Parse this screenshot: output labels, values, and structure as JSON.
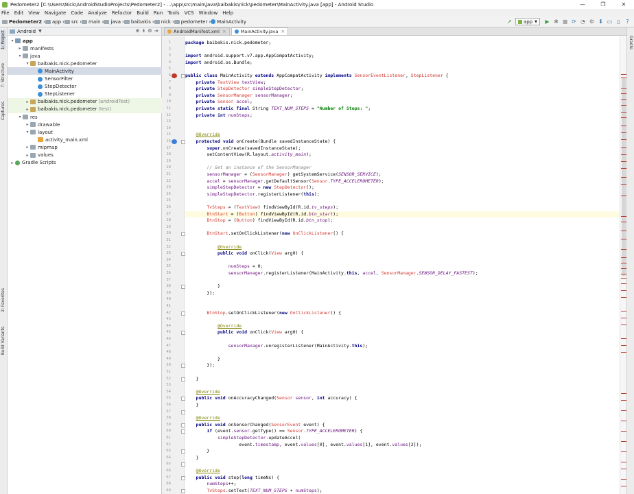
{
  "window": {
    "title": "Pedometer2 [C:\\Users\\Nick\\AndroidStudioProjects\\Pedometer2] - ...\\app\\src\\main\\java\\baibakis\\nick\\pedometer\\MainActivity.java [app] - Android Studio",
    "minimize": "—",
    "maximize": "❐",
    "close": "✕"
  },
  "menu": [
    "File",
    "Edit",
    "View",
    "Navigate",
    "Code",
    "Analyze",
    "Refactor",
    "Build",
    "Run",
    "Tools",
    "VCS",
    "Window",
    "Help"
  ],
  "breadcrumb": [
    "Pedometer2",
    "app",
    "src",
    "main",
    "java",
    "baibakis",
    "nick",
    "pedometer",
    "MainActivity"
  ],
  "toolbar": {
    "run_config": "app",
    "icons": [
      "back-arrow-icon",
      "run-icon",
      "debug-icon",
      "stop-icon",
      "sync-icon",
      "profile-icon",
      "sdk-manager-icon",
      "avd-manager-icon",
      "device-icon",
      "help-icon"
    ]
  },
  "left_tabs": [
    "1: Project",
    "7: Structure",
    "Captures",
    "2: Favorites",
    "Build Variants"
  ],
  "right_tabs": [
    "Gradle"
  ],
  "project_panel": {
    "view_mode": "Android",
    "tree": [
      {
        "label": "app",
        "depth": 0,
        "open": true,
        "icon": "folderblue",
        "bold": true
      },
      {
        "label": "manifests",
        "depth": 1,
        "open": false,
        "icon": "folder"
      },
      {
        "label": "java",
        "depth": 1,
        "open": true,
        "icon": "folder"
      },
      {
        "label": "baibakis.nick.pedometer",
        "depth": 2,
        "open": true,
        "icon": "pkg"
      },
      {
        "label": "MainActivity",
        "depth": 3,
        "icon": "cls",
        "selected": true
      },
      {
        "label": "SensorFilter",
        "depth": 3,
        "icon": "cls"
      },
      {
        "label": "StepDetector",
        "depth": 3,
        "icon": "cls"
      },
      {
        "label": "StepListener",
        "depth": 3,
        "icon": "cls"
      },
      {
        "label": "baibakis.nick.pedometer",
        "hint": "(androidTest)",
        "depth": 2,
        "open": false,
        "icon": "pkg",
        "tinted": true
      },
      {
        "label": "baibakis.nick.pedometer",
        "hint": "(test)",
        "depth": 2,
        "open": false,
        "icon": "pkg",
        "tinted": true
      },
      {
        "label": "res",
        "depth": 1,
        "open": true,
        "icon": "folder"
      },
      {
        "label": "drawable",
        "depth": 2,
        "open": false,
        "icon": "folder"
      },
      {
        "label": "layout",
        "depth": 2,
        "open": true,
        "icon": "folder"
      },
      {
        "label": "activity_main.xml",
        "depth": 3,
        "icon": "xml"
      },
      {
        "label": "mipmap",
        "depth": 2,
        "open": false,
        "icon": "folder"
      },
      {
        "label": "values",
        "depth": 2,
        "open": false,
        "icon": "folder"
      },
      {
        "label": "Gradle Scripts",
        "depth": 0,
        "open": false,
        "icon": "gradle"
      }
    ]
  },
  "editor": {
    "tabs": [
      {
        "label": "AndroidManifest.xml",
        "active": false
      },
      {
        "label": "MainActivity.java",
        "active": true
      }
    ],
    "highlighted_line": 27,
    "lines": [
      "package baibakis.nick.pedometer;",
      "",
      "import android.support.v7.app.AppCompatActivity;",
      "import android.os.Bundle;",
      "",
      "public class MainActivity extends AppCompatActivity implements SensorEventListener, StepListener {",
      "    private TextView textView;",
      "    private StepDetector simpleStepDetector;",
      "    private SensorManager sensorManager;",
      "    private Sensor accel;",
      "    private static final String TEXT_NUM_STEPS = \"Number of Steps: \";",
      "    private int numSteps;",
      "",
      "",
      "    @Override",
      "    protected void onCreate(Bundle savedInstanceState) {",
      "        super.onCreate(savedInstanceState);",
      "        setContentView(R.layout.activity_main);",
      "",
      "        // Get an instance of the SensorManager",
      "        sensorManager = (SensorManager) getSystemService(SENSOR_SERVICE);",
      "        accel = sensorManager.getDefaultSensor(Sensor.TYPE_ACCELEROMETER);",
      "        simpleStepDetector = new StepDetector();",
      "        simpleStepDetector.registerListener(this);",
      "",
      "        TvSteps = (TextView) findViewById(R.id.tv_steps);",
      "        BtnStart = (Button) findViewById(R.id.btn_start);",
      "        BtnStop = (Button) findViewById(R.id.btn_stop);",
      "",
      "        BtnStart.setOnClickListener(new OnClickListener() {",
      "",
      "            @Override",
      "            public void onClick(View arg0) {",
      "",
      "                numSteps = 0;",
      "                sensorManager.registerListener(MainActivity.this, accel, SensorManager.SENSOR_DELAY_FASTEST);",
      "",
      "            }",
      "        });",
      "",
      "",
      "        BtnStop.setOnClickListener(new OnClickListener() {",
      "",
      "            @Override",
      "            public void onClick(View arg0) {",
      "",
      "                sensorManager.unregisterListener(MainActivity.this);",
      "",
      "            }",
      "        });",
      "",
      "    }",
      "",
      "    @Override",
      "    public void onAccuracyChanged(Sensor sensor, int accuracy) {",
      "    }",
      "",
      "    @Override",
      "    public void onSensorChanged(SensorEvent event) {",
      "        if (event.sensor.getType() == Sensor.TYPE_ACCELEROMETER) {",
      "            simpleStepDetector.updateAccel(",
      "                    event.timestamp, event.values[0], event.values[1], event.values[2]);",
      "        }",
      "    }",
      "",
      "    @Override",
      "    public void step(long timeNs) {",
      "        numSteps++;",
      "        TvSteps.setText(TEXT_NUM_STEPS + numSteps);",
      "    }",
      "",
      "}"
    ]
  }
}
